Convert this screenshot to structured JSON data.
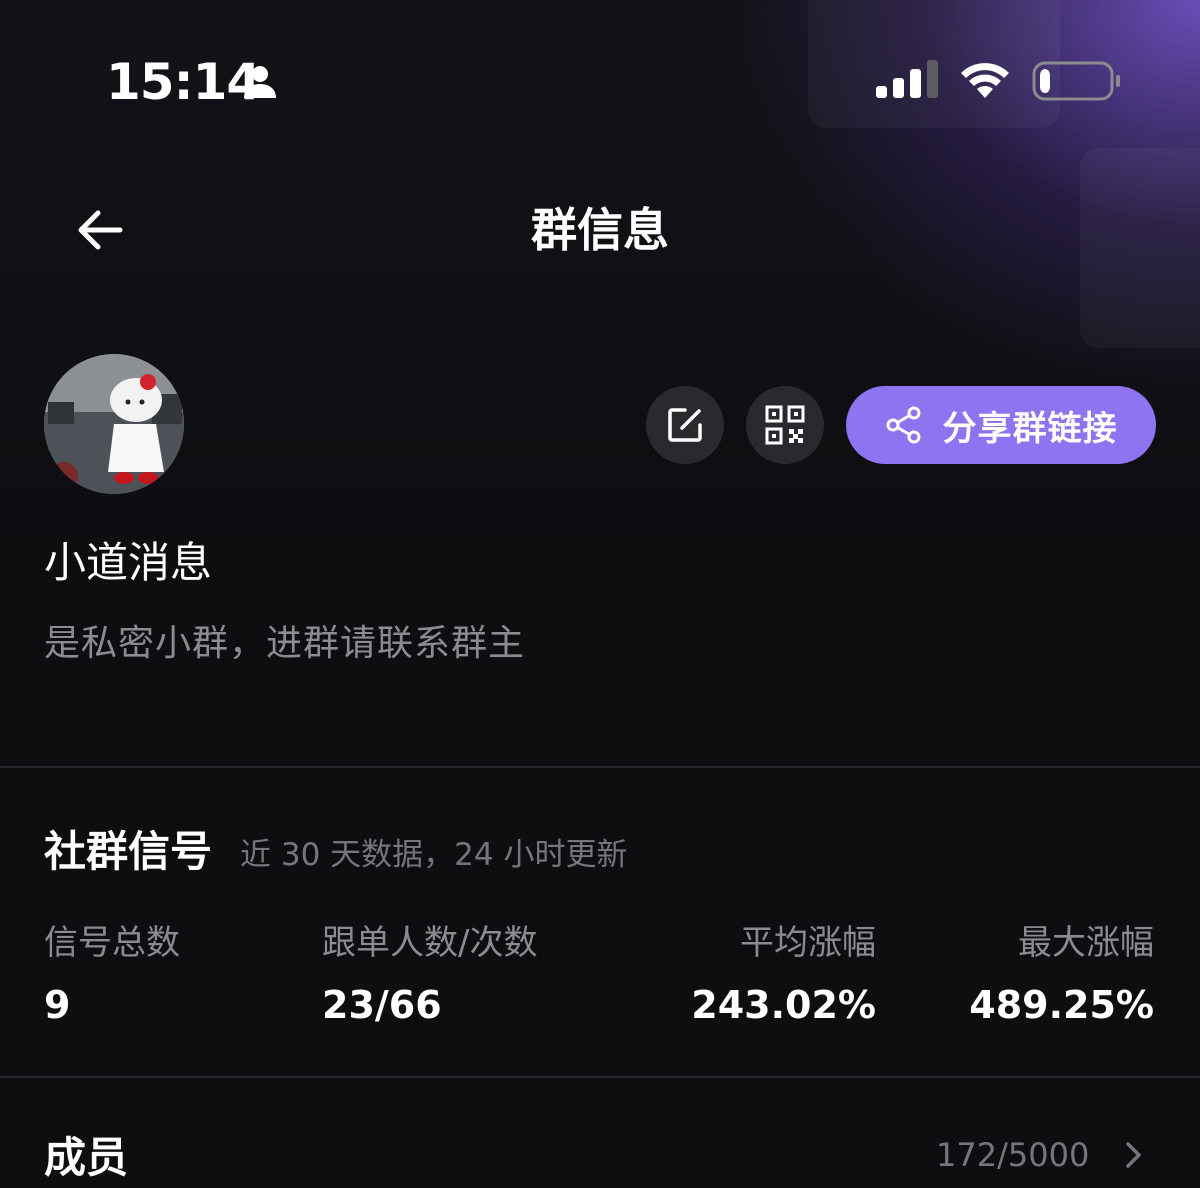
{
  "status_bar": {
    "time": "15:14",
    "icons": [
      "person-icon",
      "signal-icon",
      "wifi-icon",
      "battery-icon"
    ],
    "battery_level": 0.15
  },
  "nav": {
    "title": "群信息",
    "back_icon": "arrow-left-icon"
  },
  "group": {
    "name": "小道消息",
    "description": "是私密小群，进群请联系群主",
    "actions": {
      "edit_icon": "edit-icon",
      "qr_icon": "qr-code-icon",
      "share_label": "分享群链接",
      "share_icon": "share-icon"
    }
  },
  "signals": {
    "title": "社群信号",
    "subtitle": "近 30 天数据，24 小时更新",
    "stats": [
      {
        "label": "信号总数",
        "value": "9"
      },
      {
        "label": "跟单人数/次数",
        "value": "23/66"
      },
      {
        "label": "平均涨幅",
        "value": "243.02%"
      },
      {
        "label": "最大涨幅",
        "value": "489.25%"
      }
    ]
  },
  "members": {
    "label": "成员",
    "count": "172/5000"
  },
  "colors": {
    "background": "#0e0e11",
    "accent": "#8e74f0",
    "button_bg": "#2a2a2e",
    "muted_text": "#8b8b92"
  }
}
